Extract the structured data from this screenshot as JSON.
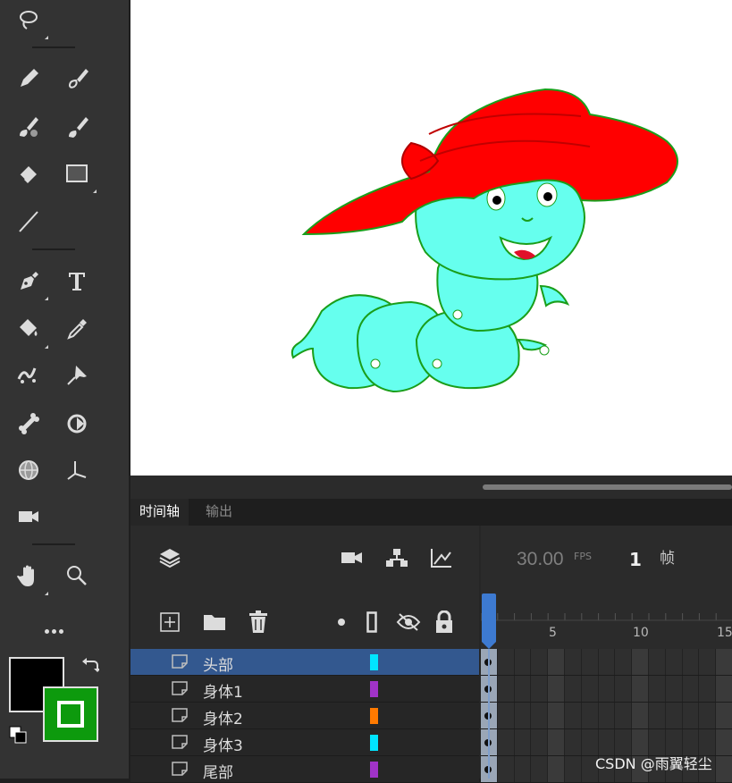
{
  "toolbar": {
    "tools": [
      {
        "name": "lasso-tool",
        "icon": "lasso-icon",
        "has_submenu": true
      },
      {
        "name": "pencil-tool",
        "icon": "pencil-icon"
      },
      {
        "name": "paint-brush-tool",
        "icon": "paint-brush-icon"
      },
      {
        "name": "fluid-brush-tool",
        "icon": "fluid-brush-icon"
      },
      {
        "name": "classic-brush-tool",
        "icon": "classic-brush-icon"
      },
      {
        "name": "eraser-tool",
        "icon": "eraser-icon"
      },
      {
        "name": "rectangle-tool",
        "icon": "rectangle-icon",
        "has_submenu": true
      },
      {
        "name": "line-tool",
        "icon": "line-icon"
      },
      {
        "name": "pen-tool",
        "icon": "pen-icon",
        "has_submenu": true
      },
      {
        "name": "text-tool",
        "icon": "text-icon"
      },
      {
        "name": "paint-bucket-tool",
        "icon": "paint-bucket-icon",
        "has_submenu": true
      },
      {
        "name": "eyedropper-tool",
        "icon": "eyedropper-icon"
      },
      {
        "name": "asset-warp-tool",
        "icon": "asset-warp-icon"
      },
      {
        "name": "pin-tool",
        "icon": "pin-icon"
      },
      {
        "name": "bone-tool",
        "icon": "bone-icon"
      },
      {
        "name": "rotate-3d-tool",
        "icon": "rotate-3d-icon"
      },
      {
        "name": "globe-tool",
        "icon": "globe-icon"
      },
      {
        "name": "axis-3d-tool",
        "icon": "axis-3d-icon"
      },
      {
        "name": "camera-tool",
        "icon": "camera-icon"
      },
      {
        "name": "hand-tool",
        "icon": "hand-icon",
        "has_submenu": true
      },
      {
        "name": "zoom-tool",
        "icon": "zoom-icon"
      }
    ],
    "stroke_color": "#000000",
    "fill_color": "#0d9a0d"
  },
  "timeline": {
    "tabs": [
      {
        "label": "时间轴",
        "active": true
      },
      {
        "label": "输出",
        "active": false
      }
    ],
    "fps_value": "30.00",
    "fps_unit": "FPS",
    "current_frame": "1",
    "frame_unit": "帧",
    "ruler_labels": [
      "5",
      "10",
      "15"
    ],
    "layers": [
      {
        "name": "头部",
        "color": "#00e5ff",
        "selected": true
      },
      {
        "name": "身体1",
        "color": "#a033c8",
        "selected": false
      },
      {
        "name": "身体2",
        "color": "#ff7a00",
        "selected": false
      },
      {
        "name": "身体3",
        "color": "#00e5ff",
        "selected": false
      },
      {
        "name": "尾部",
        "color": "#a033c8",
        "selected": false
      }
    ]
  },
  "watermark": "CSDN @雨翼轻尘",
  "colors": {
    "hat": "#ff0000",
    "body": "#66ffee",
    "outline": "#1a9e1a",
    "selection": "#33588f",
    "playhead": "#3d7ad1"
  }
}
